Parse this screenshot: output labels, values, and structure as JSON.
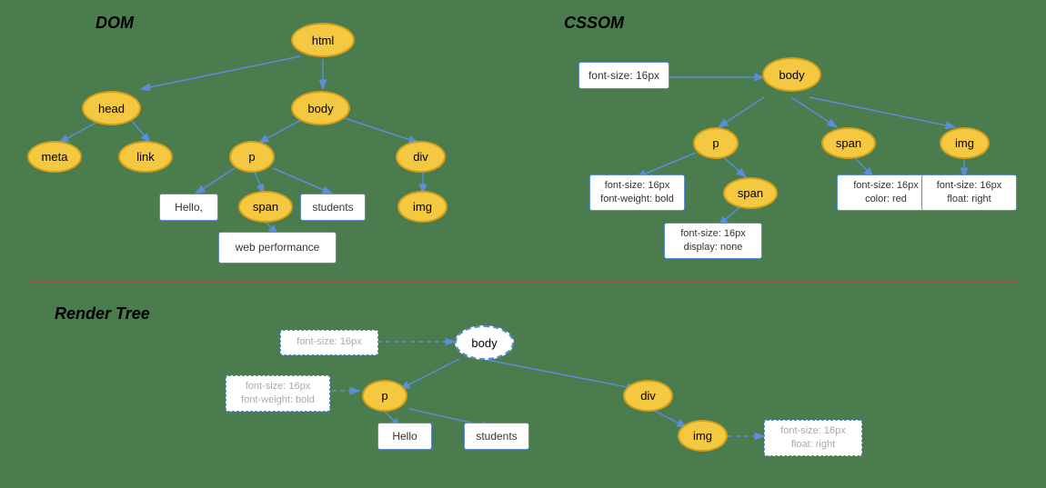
{
  "sections": {
    "dom": {
      "title": "DOM",
      "nodes": {
        "html": "html",
        "head": "head",
        "body": "body",
        "meta": "meta",
        "link": "link",
        "p": "p",
        "span": "span",
        "div": "div",
        "img": "img",
        "hello": "Hello,",
        "students": "students",
        "web_performance": "web performance"
      }
    },
    "cssom": {
      "title": "CSSOM",
      "nodes": {
        "body": "body",
        "p": "p",
        "span_p": "span",
        "span": "span",
        "img": "img",
        "body_style": "font-size: 16px",
        "p_style": "font-size: 16px\nfont-weight: bold",
        "span_p_style": "font-size: 16px\ndisplay: none",
        "span_style": "font-size: 16px\ncolor: red",
        "img_style": "font-size: 16px\nfloat: right"
      }
    },
    "render_tree": {
      "title": "Render Tree",
      "nodes": {
        "body": "body",
        "p": "p",
        "div": "div",
        "img": "img",
        "hello": "Hello",
        "students": "students",
        "body_style": "font-size: 16px",
        "p_style": "font-size: 16px\nfont-weight: bold",
        "img_style": "font-size: 16px\nfloat: right"
      }
    }
  }
}
